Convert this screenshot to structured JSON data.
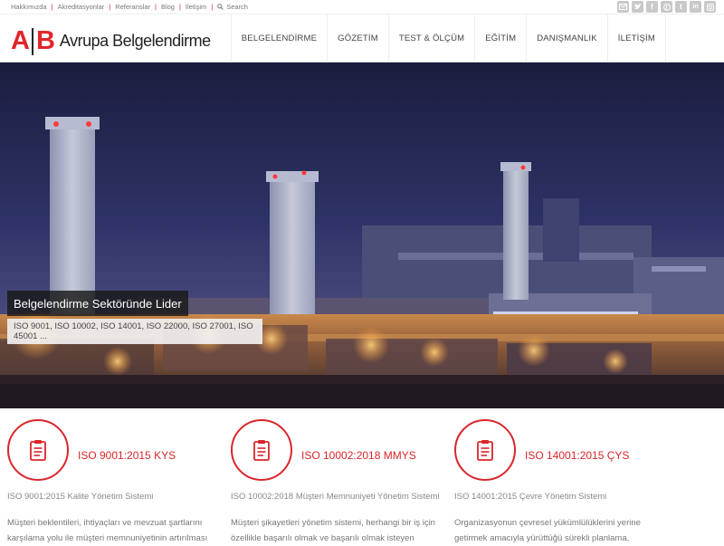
{
  "topbar": {
    "links": [
      "Hakkımızda",
      "Akreditasyonlar",
      "Referanslar",
      "Blog",
      "İletişim"
    ],
    "search_label": "Search",
    "social_icons": [
      "mail-icon",
      "twitter-icon",
      "facebook-icon",
      "pinterest-icon",
      "tumblr-icon",
      "linkedin-icon",
      "instagram-icon"
    ]
  },
  "logo": {
    "letter_a": "A",
    "letter_b": "B",
    "name": "Avrupa Belgelendirme",
    "color": "#e0262a"
  },
  "nav": {
    "items": [
      "BELGELENDİRME",
      "GÖZETİM",
      "TEST & ÖLÇÜM",
      "EĞİTİM",
      "DANIŞMANLIK",
      "İLETİŞİM"
    ]
  },
  "hero": {
    "title": "Belgelendirme Sektöründe Lider",
    "subtitle": "ISO 9001, ISO 10002, ISO 14001, ISO 22000, ISO 27001, ISO 45001 ..."
  },
  "features": [
    {
      "icon": "clipboard-icon",
      "title": "ISO 9001:2015 KYS",
      "subtitle": "ISO 9001:2015 Kalite Yönetim Sistemi",
      "desc_lines": [
        "Müşteri beklentileri, ihtiyaçları ve mevzuat şartlarını",
        "karşılama yolu ile müşteri memnuniyetinin artırılması"
      ]
    },
    {
      "icon": "clipboard-icon",
      "title": "ISO 10002:2018 MMYS",
      "subtitle": "ISO 10002:2018 Müşteri Memnuniyeti Yönetim Sistemi",
      "desc_lines": [
        "Müşteri şikayetleri yönetim sistemi, herhangi bir iş için",
        "özellikle başarılı olmak ve başarılı olmak isteyen"
      ]
    },
    {
      "icon": "clipboard-icon",
      "title": "ISO 14001:2015 ÇYS",
      "subtitle": "ISO 14001:2015 Çevre Yönetim Sistemi",
      "desc_lines": [
        "Organizasyonun çevresel yükümlülüklerini yerine",
        "getirmek amacıyla yürüttüğü sürekli planlama,"
      ]
    }
  ],
  "accent_color": "#d9262b"
}
